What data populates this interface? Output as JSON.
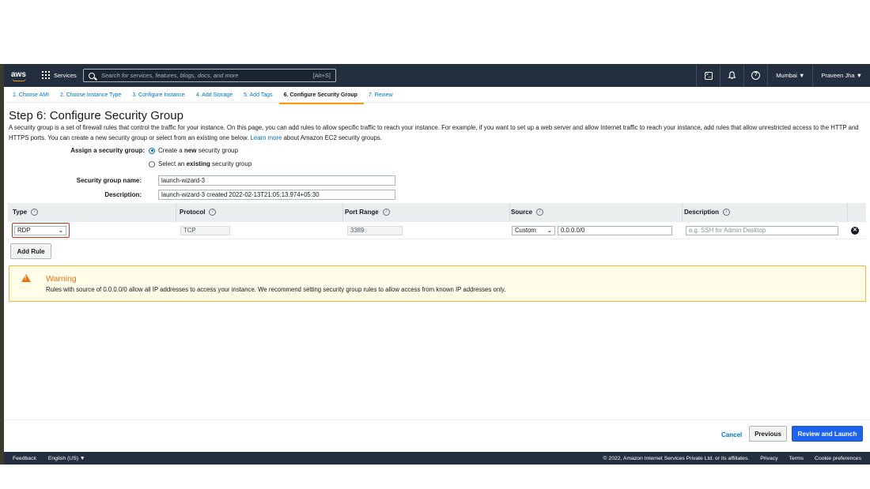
{
  "topnav": {
    "logo": "aws",
    "services": "Services",
    "search_placeholder": "Search for services, features, blogs, docs, and more",
    "search_shortcut": "[Alt+S]",
    "region": "Mumbai ▼",
    "user": "Praveen Jha ▼"
  },
  "tabs": [
    {
      "label": "1. Choose AMI"
    },
    {
      "label": "2. Choose Instance Type"
    },
    {
      "label": "3. Configure Instance"
    },
    {
      "label": "4. Add Storage"
    },
    {
      "label": "5. Add Tags"
    },
    {
      "label": "6. Configure Security Group"
    },
    {
      "label": "7. Review"
    }
  ],
  "page": {
    "title": "Step 6: Configure Security Group",
    "intro": "A security group is a set of firewall rules that control the traffic for your instance. On this page, you can add rules to allow specific traffic to reach your instance. For example, if you want to set up a web server and allow Internet traffic to reach your instance, add rules that allow unrestricted access to the HTTP and HTTPS ports. You can create a new security group or select from an existing one below.",
    "learn_more": "Learn more",
    "intro_tail": "about Amazon EC2 security groups."
  },
  "form": {
    "assign_label": "Assign a security group:",
    "option_new_pre": "Create a ",
    "option_new_bold": "new",
    "option_new_post": " security group",
    "option_existing_pre": "Select an ",
    "option_existing_bold": "existing",
    "option_existing_post": " security group",
    "name_label": "Security group name:",
    "name_value": "launch-wizard-3",
    "desc_label": "Description:",
    "desc_value": "launch-wizard-3 created 2022-02-13T21:05:13.974+05:30"
  },
  "rules_table": {
    "headers": [
      "Type",
      "Protocol",
      "Port Range",
      "Source",
      "Description"
    ],
    "row": {
      "type": "RDP",
      "protocol": "TCP",
      "port_range": "3389",
      "source_select": "Custom",
      "source_cidr": "0.0.0.0/0",
      "description_placeholder": "e.g. SSH for Admin Desktop"
    },
    "add_rule": "Add Rule"
  },
  "warning": {
    "title": "Warning",
    "text": "Rules with source of 0.0.0.0/0 allow all IP addresses to access your instance. We recommend setting security group rules to allow access from known IP addresses only."
  },
  "actions": {
    "cancel": "Cancel",
    "previous": "Previous",
    "review": "Review and Launch"
  },
  "footer": {
    "feedback": "Feedback",
    "language": "English (US) ▼",
    "copyright": "© 2022, Amazon Internet Services Private Ltd. or its affiliates.",
    "privacy": "Privacy",
    "terms": "Terms",
    "cookies": "Cookie preferences"
  },
  "colors": {
    "nav_bg": "#232f3e",
    "link": "#0073bb",
    "primary_button": "#1d63ed",
    "warning_accent": "#ec7211"
  }
}
